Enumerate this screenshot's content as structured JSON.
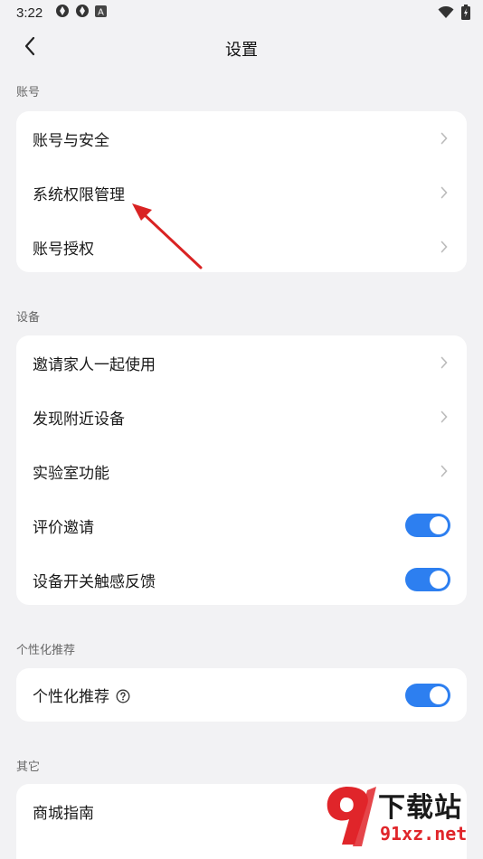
{
  "status_bar": {
    "time": "3:22",
    "notif_icon_3": "A"
  },
  "header": {
    "title": "设置"
  },
  "sections": {
    "account": {
      "label": "账号",
      "items": [
        "账号与安全",
        "系统权限管理",
        "账号授权"
      ]
    },
    "device": {
      "label": "设备",
      "items": [
        "邀请家人一起使用",
        "发现附近设备",
        "实验室功能"
      ],
      "toggles": [
        {
          "label": "评价邀请",
          "on": true
        },
        {
          "label": "设备开关触感反馈",
          "on": true
        }
      ]
    },
    "personal": {
      "label": "个性化推荐",
      "toggle": {
        "label": "个性化推荐",
        "on": true
      }
    },
    "other": {
      "label": "其它",
      "items": [
        "商城指南"
      ]
    }
  },
  "watermark": {
    "brand": "下载站",
    "site": "91xz.net"
  },
  "colors": {
    "accent": "#2d7ff0",
    "annotation_arrow": "#d92323",
    "background": "#f2f2f4"
  }
}
